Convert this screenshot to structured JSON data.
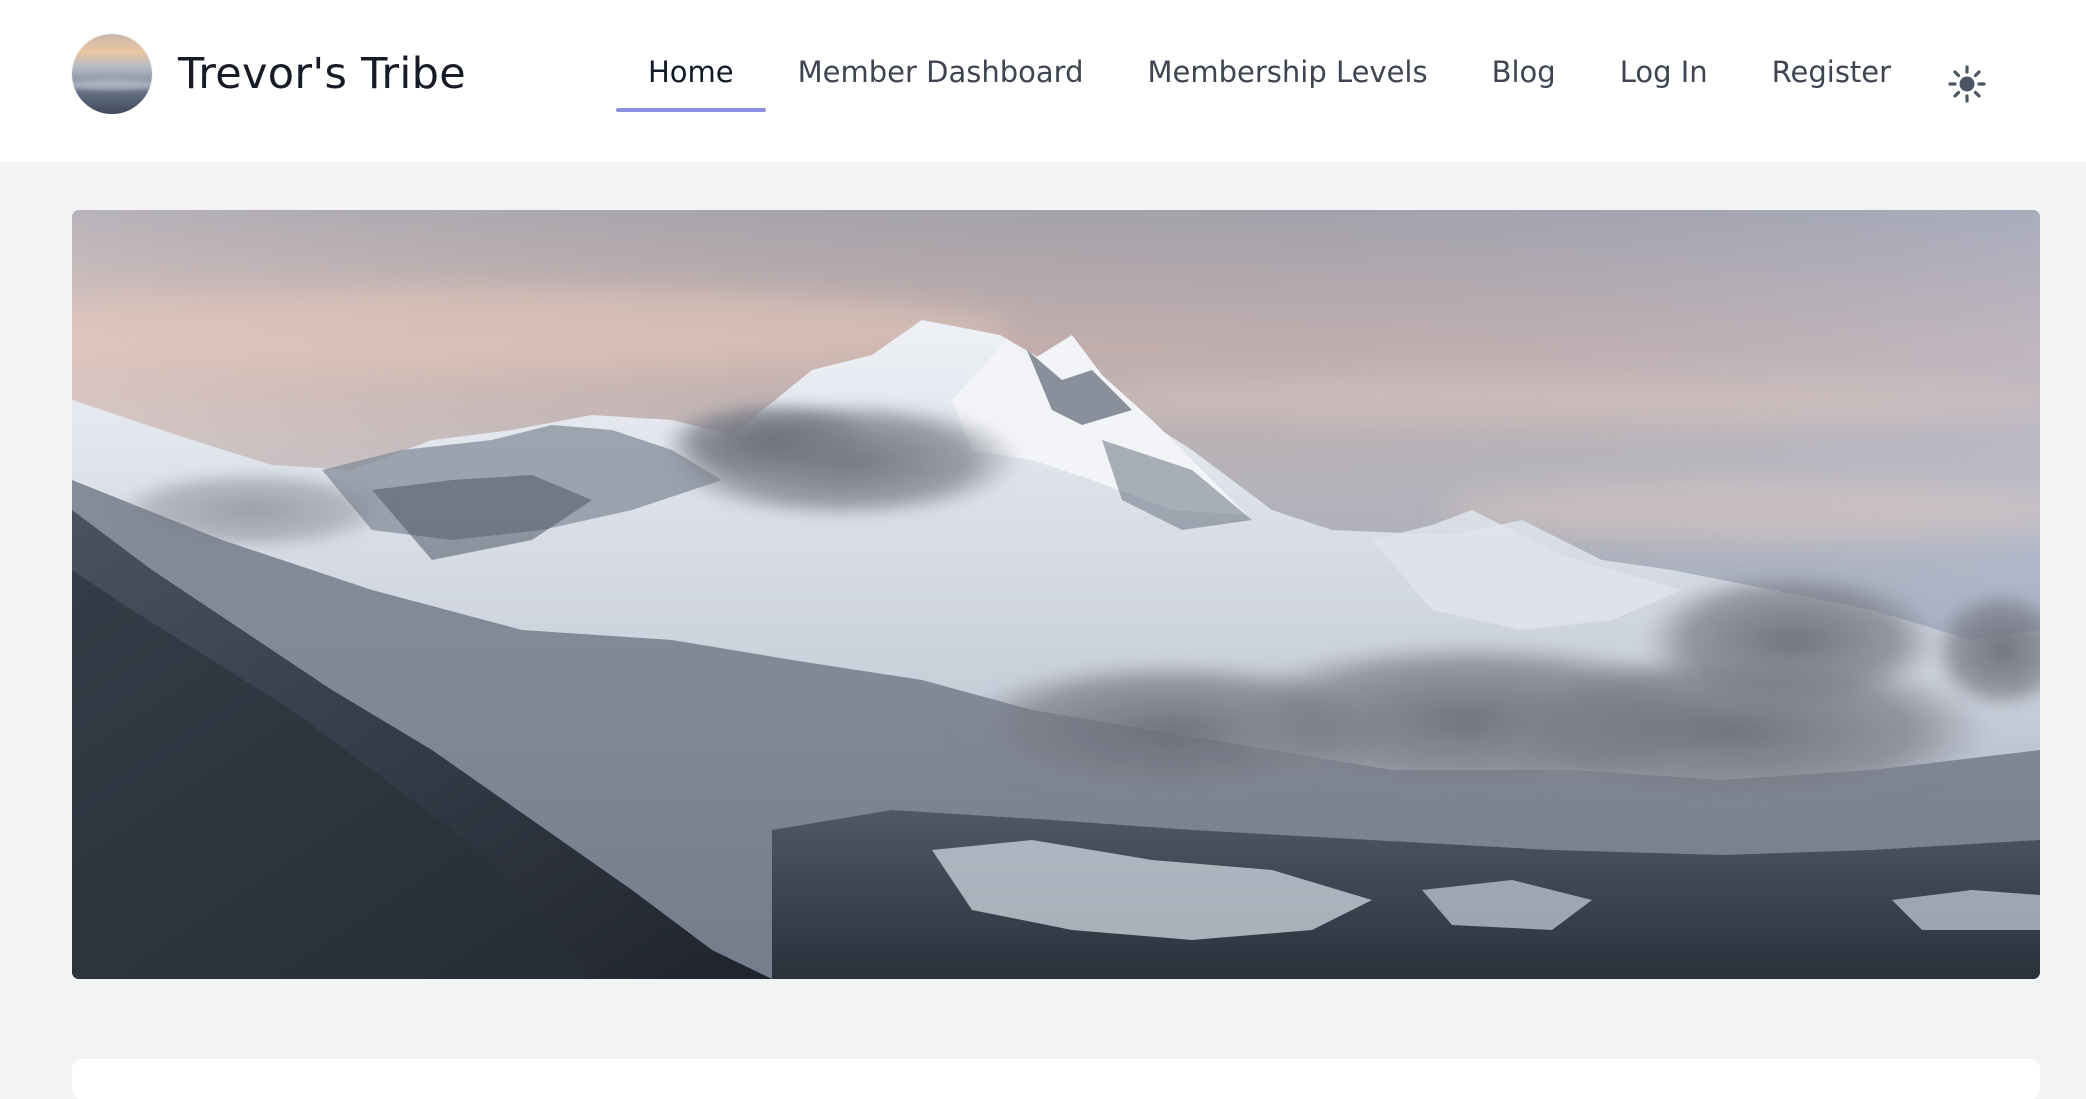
{
  "site": {
    "title": "Trevor's Tribe",
    "logo_icon": "mountain-avatar-icon"
  },
  "nav": {
    "items": [
      {
        "label": "Home",
        "active": true
      },
      {
        "label": "Member Dashboard",
        "active": false
      },
      {
        "label": "Membership Levels",
        "active": false
      },
      {
        "label": "Blog",
        "active": false
      },
      {
        "label": "Log In",
        "active": false
      },
      {
        "label": "Register",
        "active": false
      }
    ],
    "active_underline_color": "#8c91e0"
  },
  "theme_toggle": {
    "icon": "sun-icon"
  },
  "hero": {
    "image": "snowy-mountain-peak-with-clouds"
  },
  "colors": {
    "page_background": "#f2f3f5",
    "header_background": "#ffffff",
    "title_text": "#171b27",
    "nav_text": "#3e4452"
  }
}
